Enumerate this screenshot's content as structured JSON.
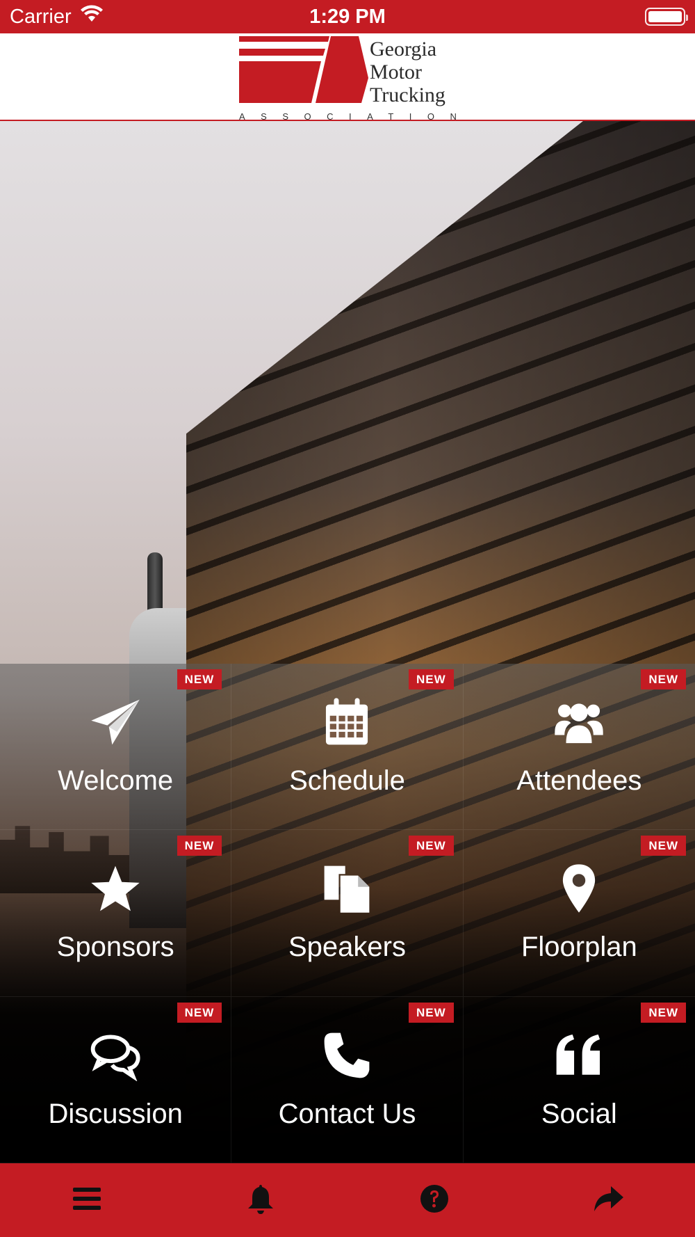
{
  "status_bar": {
    "carrier": "Carrier",
    "time": "1:29 PM"
  },
  "header": {
    "logo_line1": "Georgia",
    "logo_line2": "Motor",
    "logo_line3": "Trucking",
    "logo_subtitle": "ASSOCIATION"
  },
  "colors": {
    "brand_red": "#c41c23",
    "header_bg": "#ffffff",
    "text_light": "#ffffff"
  },
  "menu": {
    "badge_text": "NEW",
    "tiles": [
      {
        "label": "Welcome",
        "icon": "paper-plane-icon"
      },
      {
        "label": "Schedule",
        "icon": "calendar-icon"
      },
      {
        "label": "Attendees",
        "icon": "users-icon"
      },
      {
        "label": "Sponsors",
        "icon": "star-icon"
      },
      {
        "label": "Speakers",
        "icon": "documents-icon"
      },
      {
        "label": "Floorplan",
        "icon": "map-marker-icon"
      },
      {
        "label": "Discussion",
        "icon": "chat-bubbles-icon"
      },
      {
        "label": "Contact Us",
        "icon": "phone-icon"
      },
      {
        "label": "Social",
        "icon": "quote-icon"
      }
    ]
  },
  "toolbar": {
    "items": [
      {
        "icon": "hamburger-menu-icon"
      },
      {
        "icon": "bell-icon"
      },
      {
        "icon": "help-icon"
      },
      {
        "icon": "share-icon"
      }
    ]
  }
}
